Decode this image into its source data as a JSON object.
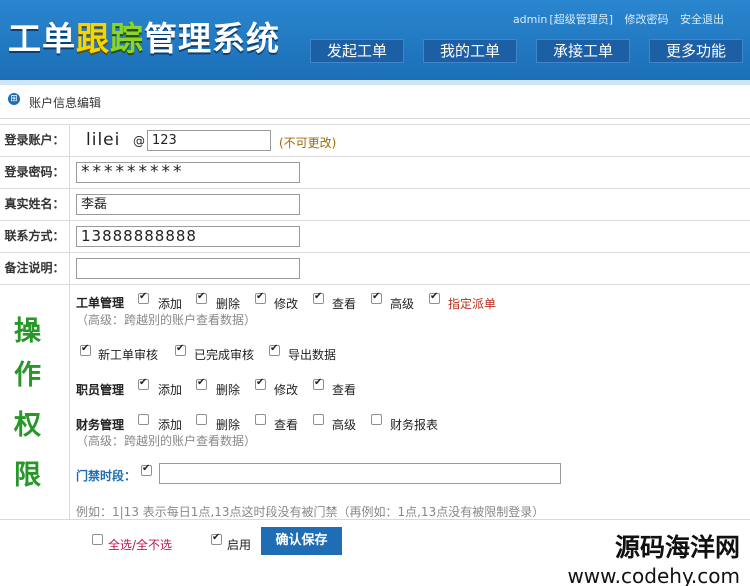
{
  "header": {
    "logo_parts": [
      "工单",
      "跟",
      "踪",
      "管理系统"
    ],
    "user": "admin",
    "role": "[超级管理员]",
    "change_password": "修改密码",
    "logout": "安全退出",
    "nav": [
      "发起工单",
      "我的工单",
      "承接工单",
      "更多功能"
    ]
  },
  "section": {
    "title": "账户信息编辑"
  },
  "form": {
    "account": {
      "label": "登录账户：",
      "prefix": "lilei",
      "at": "@",
      "value": "123",
      "note": "(不可更改)"
    },
    "password": {
      "label": "登录密码：",
      "value": "*********"
    },
    "realname": {
      "label": "真实姓名：",
      "value": "李磊"
    },
    "contact": {
      "label": "联系方式：",
      "value": "13888888888"
    },
    "remark": {
      "label": "备注说明：",
      "value": ""
    }
  },
  "permissions": {
    "label_chars": [
      "操",
      "作",
      "权",
      "限"
    ],
    "workorder": {
      "title": "工单管理",
      "items": [
        {
          "label": "添加",
          "checked": true
        },
        {
          "label": "删除",
          "checked": true
        },
        {
          "label": "修改",
          "checked": true
        },
        {
          "label": "查看",
          "checked": true
        },
        {
          "label": "高级",
          "checked": true
        },
        {
          "label": "指定派单",
          "checked": true
        }
      ],
      "note": "（高级：跨越别的账户查看数据）",
      "items2": [
        {
          "label": "新工单审核",
          "checked": true
        },
        {
          "label": "已完成审核",
          "checked": true
        },
        {
          "label": "导出数据",
          "checked": true
        }
      ]
    },
    "staff": {
      "title": "职员管理",
      "items": [
        {
          "label": "添加",
          "checked": true
        },
        {
          "label": "删除",
          "checked": true
        },
        {
          "label": "修改",
          "checked": true
        },
        {
          "label": "查看",
          "checked": true
        }
      ]
    },
    "finance": {
      "title": "财务管理",
      "items": [
        {
          "label": "添加",
          "checked": false
        },
        {
          "label": "删除",
          "checked": false
        },
        {
          "label": "查看",
          "checked": false
        },
        {
          "label": "高级",
          "checked": false
        },
        {
          "label": "财务报表",
          "checked": false
        }
      ],
      "note": "（高级：跨越别的账户查看数据）"
    },
    "access": {
      "title": "门禁时段：",
      "checked": true,
      "value": "",
      "example": "例如：1|13 表示每日1点,13点这时段没有被门禁（再例如：1点,13点没有被限制登录）"
    }
  },
  "footer": {
    "select_all": "全选/全不选",
    "select_all_checked": false,
    "enable": "启用",
    "enable_checked": true,
    "save": "确认保存"
  },
  "watermark": {
    "line1": "源码海洋网",
    "line2": "www.codehy.com"
  }
}
